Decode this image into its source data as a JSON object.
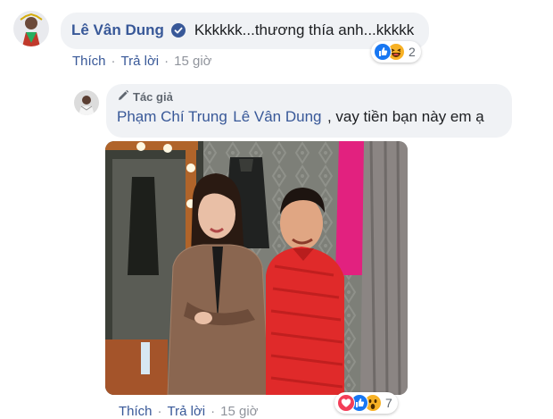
{
  "comment1": {
    "author": "Lê Vân Dung",
    "text": "Kkkkkk...thương thía anh...kkkkk",
    "actions": {
      "like": "Thích",
      "reply": "Trả lời",
      "time": "15 giờ"
    },
    "reactions": {
      "count": "2",
      "icons": [
        "like-icon",
        "haha-icon"
      ]
    }
  },
  "reply1": {
    "badge": "Tác giả",
    "author": "Phạm Chí Trung",
    "mention": "Lê Vân Dung",
    "text": ", vay tiền bạn này em ạ",
    "actions": {
      "like": "Thích",
      "reply": "Trả lời",
      "time": "15 giờ"
    },
    "reactions": {
      "count": "7",
      "icons": [
        "love-icon",
        "like-icon",
        "wow-icon"
      ]
    }
  },
  "colors": {
    "link": "#385898",
    "bubble": "#f0f2f5",
    "muted": "#90949c",
    "verified": "#385898"
  }
}
